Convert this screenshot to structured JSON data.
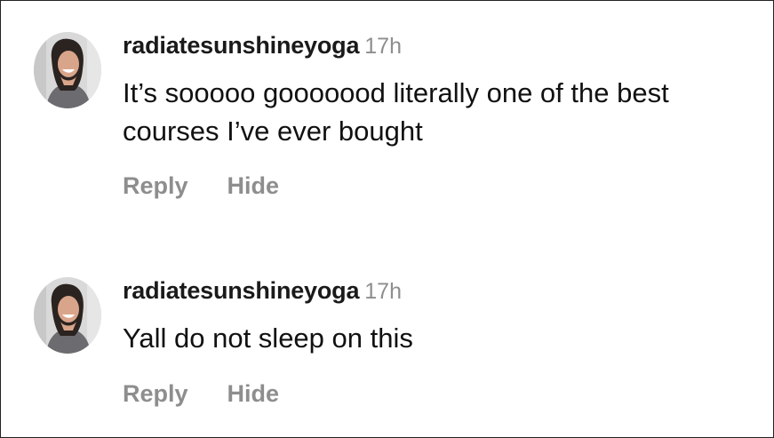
{
  "comments": [
    {
      "username": "radiatesunshineyoga",
      "time": "17h",
      "text": "It’s sooooo gooooood literally one of the best courses I’ve ever bought",
      "reply_label": "Reply",
      "hide_label": "Hide"
    },
    {
      "username": "radiatesunshineyoga",
      "time": "17h",
      "text": "Yall do not sleep on this",
      "reply_label": "Reply",
      "hide_label": "Hide"
    }
  ],
  "colors": {
    "username": "#1a1a1a",
    "secondary": "#8e8e8e",
    "body": "#111111",
    "border": "#222222"
  }
}
